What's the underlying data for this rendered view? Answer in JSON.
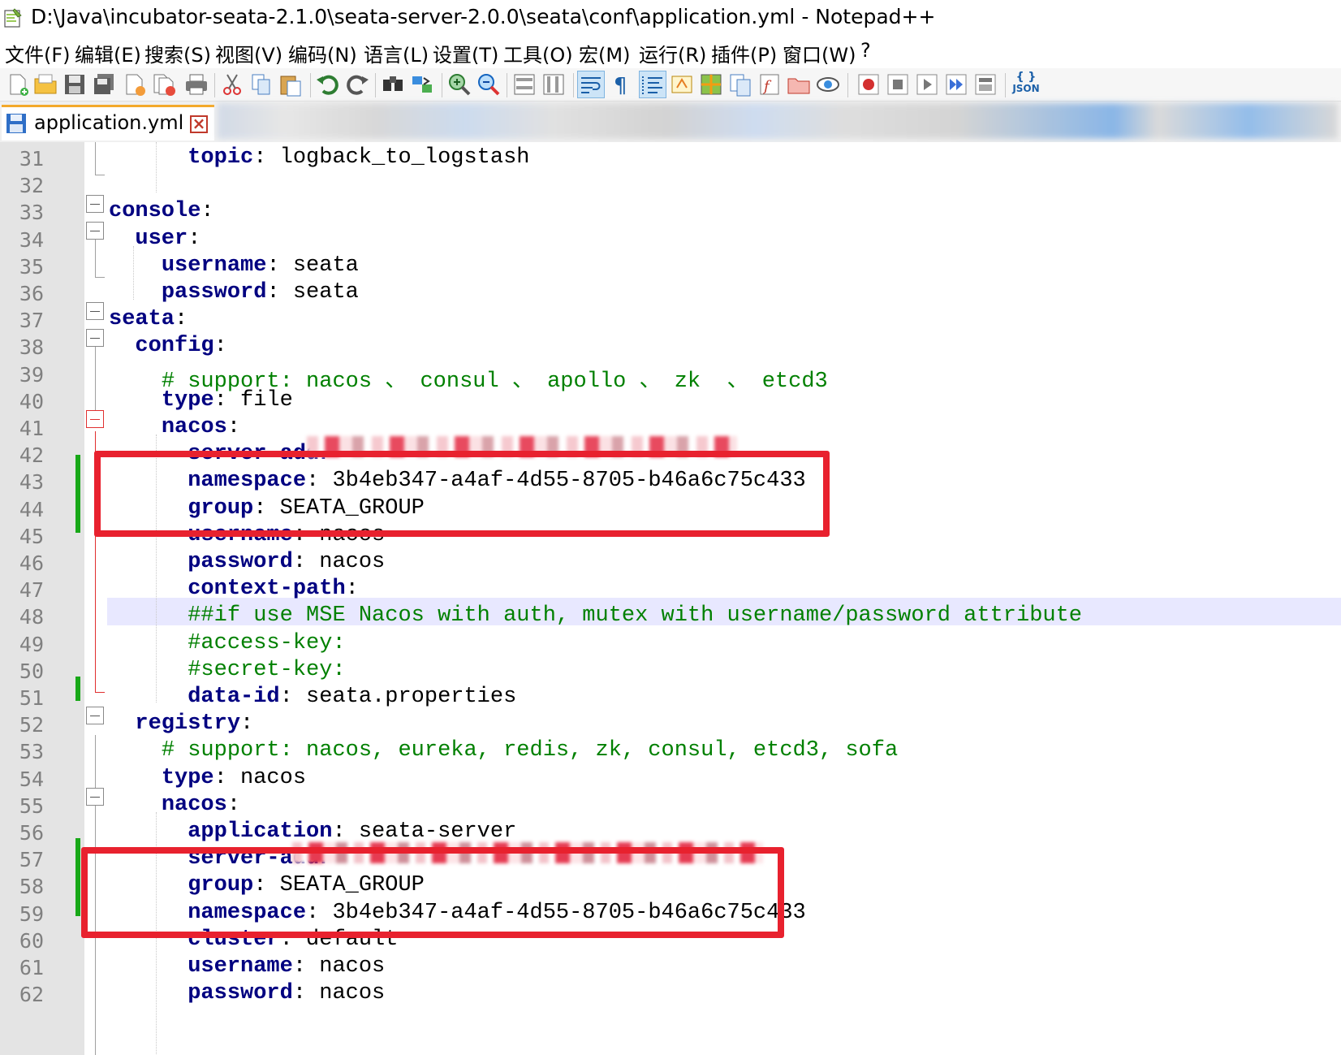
{
  "window": {
    "title": "D:\\Java\\incubator-seata-2.1.0\\seata-server-2.0.0\\seata\\conf\\application.yml - Notepad++"
  },
  "menu": [
    {
      "label": "文件(F)"
    },
    {
      "label": "编辑(E)"
    },
    {
      "label": "搜索(S)"
    },
    {
      "label": "视图(V)"
    },
    {
      "label": "编码(N)"
    },
    {
      "label": "语言(L)"
    },
    {
      "label": "设置(T)"
    },
    {
      "label": "工具(O)"
    },
    {
      "label": "宏(M)"
    },
    {
      "label": "运行(R)"
    },
    {
      "label": "插件(P)"
    },
    {
      "label": "窗口(W)"
    },
    {
      "label": "?"
    }
  ],
  "tab": {
    "label": "application.yml",
    "close": "x"
  },
  "toolbar": {
    "json_label": "JSON"
  },
  "editor": {
    "lines": [
      {
        "num": "31",
        "parts": [
          {
            "t": "      ",
            "c": "val"
          },
          {
            "t": "topic",
            "c": "key"
          },
          {
            "t": ": logback_to_logstash",
            "c": "val"
          }
        ]
      },
      {
        "num": "32",
        "parts": []
      },
      {
        "num": "33",
        "parts": [
          {
            "t": "console",
            "c": "key"
          },
          {
            "t": ":",
            "c": "val"
          }
        ]
      },
      {
        "num": "34",
        "parts": [
          {
            "t": "  ",
            "c": "val"
          },
          {
            "t": "user",
            "c": "key"
          },
          {
            "t": ":",
            "c": "val"
          }
        ]
      },
      {
        "num": "35",
        "parts": [
          {
            "t": "    ",
            "c": "val"
          },
          {
            "t": "username",
            "c": "key"
          },
          {
            "t": ": seata",
            "c": "val"
          }
        ]
      },
      {
        "num": "36",
        "parts": [
          {
            "t": "    ",
            "c": "val"
          },
          {
            "t": "password",
            "c": "key"
          },
          {
            "t": ": seata",
            "c": "val"
          }
        ]
      },
      {
        "num": "37",
        "parts": [
          {
            "t": "seata",
            "c": "key"
          },
          {
            "t": ":",
            "c": "val"
          }
        ]
      },
      {
        "num": "38",
        "parts": [
          {
            "t": "  ",
            "c": "val"
          },
          {
            "t": "config",
            "c": "key"
          },
          {
            "t": ":",
            "c": "val"
          }
        ]
      },
      {
        "num": "39",
        "parts": [
          {
            "t": "    ",
            "c": "val"
          },
          {
            "t": "# support: nacos 、 consul 、 apollo 、 zk  、 etcd3",
            "c": "comment"
          }
        ]
      },
      {
        "num": "40",
        "parts": [
          {
            "t": "    ",
            "c": "val"
          },
          {
            "t": "type",
            "c": "key"
          },
          {
            "t": ": file",
            "c": "val"
          }
        ]
      },
      {
        "num": "41",
        "parts": [
          {
            "t": "    ",
            "c": "val"
          },
          {
            "t": "nacos",
            "c": "key"
          },
          {
            "t": ":",
            "c": "val"
          }
        ]
      },
      {
        "num": "42",
        "parts": [
          {
            "t": "      ",
            "c": "val"
          },
          {
            "t": "server-addr",
            "c": "key"
          }
        ]
      },
      {
        "num": "43",
        "parts": [
          {
            "t": "      ",
            "c": "val"
          },
          {
            "t": "namespace",
            "c": "key"
          },
          {
            "t": ": 3b4eb347-a4af-4d55-8705-b46a6c75c433",
            "c": "val"
          }
        ]
      },
      {
        "num": "44",
        "parts": [
          {
            "t": "      ",
            "c": "val"
          },
          {
            "t": "group",
            "c": "key"
          },
          {
            "t": ": SEATA_GROUP",
            "c": "val"
          }
        ]
      },
      {
        "num": "45",
        "parts": [
          {
            "t": "      ",
            "c": "val"
          },
          {
            "t": "username",
            "c": "key"
          },
          {
            "t": ": nacos",
            "c": "val"
          }
        ]
      },
      {
        "num": "46",
        "parts": [
          {
            "t": "      ",
            "c": "val"
          },
          {
            "t": "password",
            "c": "key"
          },
          {
            "t": ": nacos",
            "c": "val"
          }
        ]
      },
      {
        "num": "47",
        "parts": [
          {
            "t": "      ",
            "c": "val"
          },
          {
            "t": "context-path",
            "c": "key"
          },
          {
            "t": ":",
            "c": "val"
          }
        ]
      },
      {
        "num": "48",
        "parts": [
          {
            "t": "      ",
            "c": "val"
          },
          {
            "t": "##if use MSE Nacos with auth, mutex with username/password attribute",
            "c": "comment"
          }
        ]
      },
      {
        "num": "49",
        "parts": [
          {
            "t": "      ",
            "c": "val"
          },
          {
            "t": "#access-key:",
            "c": "comment"
          }
        ]
      },
      {
        "num": "50",
        "parts": [
          {
            "t": "      ",
            "c": "val"
          },
          {
            "t": "#secret-key:",
            "c": "comment"
          }
        ]
      },
      {
        "num": "51",
        "parts": [
          {
            "t": "      ",
            "c": "val"
          },
          {
            "t": "data-id",
            "c": "key"
          },
          {
            "t": ": seata.properties",
            "c": "val"
          }
        ]
      },
      {
        "num": "52",
        "parts": [
          {
            "t": "  ",
            "c": "val"
          },
          {
            "t": "registry",
            "c": "key"
          },
          {
            "t": ":",
            "c": "val"
          }
        ]
      },
      {
        "num": "53",
        "parts": [
          {
            "t": "    ",
            "c": "val"
          },
          {
            "t": "# support: nacos, eureka, redis, zk, consul, etcd3, sofa",
            "c": "comment"
          }
        ]
      },
      {
        "num": "54",
        "parts": [
          {
            "t": "    ",
            "c": "val"
          },
          {
            "t": "type",
            "c": "key"
          },
          {
            "t": ": nacos",
            "c": "val"
          }
        ]
      },
      {
        "num": "55",
        "parts": [
          {
            "t": "    ",
            "c": "val"
          },
          {
            "t": "nacos",
            "c": "key"
          },
          {
            "t": ":",
            "c": "val"
          }
        ]
      },
      {
        "num": "56",
        "parts": [
          {
            "t": "      ",
            "c": "val"
          },
          {
            "t": "application",
            "c": "key"
          },
          {
            "t": ": seata-server",
            "c": "val"
          }
        ]
      },
      {
        "num": "57",
        "parts": [
          {
            "t": "      ",
            "c": "val"
          },
          {
            "t": "server-addr",
            "c": "key"
          }
        ]
      },
      {
        "num": "58",
        "parts": [
          {
            "t": "      ",
            "c": "val"
          },
          {
            "t": "group",
            "c": "key"
          },
          {
            "t": ": SEATA_GROUP",
            "c": "val"
          }
        ]
      },
      {
        "num": "59",
        "parts": [
          {
            "t": "      ",
            "c": "val"
          },
          {
            "t": "namespace",
            "c": "key"
          },
          {
            "t": ": 3b4eb347-a4af-4d55-8705-b46a6c75c433",
            "c": "val"
          }
        ]
      },
      {
        "num": "60",
        "parts": [
          {
            "t": "      ",
            "c": "val"
          },
          {
            "t": "cluster",
            "c": "key"
          },
          {
            "t": ": default",
            "c": "val"
          }
        ]
      },
      {
        "num": "61",
        "parts": [
          {
            "t": "      ",
            "c": "val"
          },
          {
            "t": "username",
            "c": "key"
          },
          {
            "t": ": nacos",
            "c": "val"
          }
        ]
      },
      {
        "num": "62",
        "parts": [
          {
            "t": "      ",
            "c": "val"
          },
          {
            "t": "password",
            "c": "key"
          },
          {
            "t": ": nacos",
            "c": "val"
          }
        ]
      }
    ]
  },
  "colors": {
    "key": "#000080",
    "comment": "#008000",
    "annotation_red": "#e8212e",
    "current_line": "#e8e8ff",
    "change_bar": "#18a818"
  }
}
